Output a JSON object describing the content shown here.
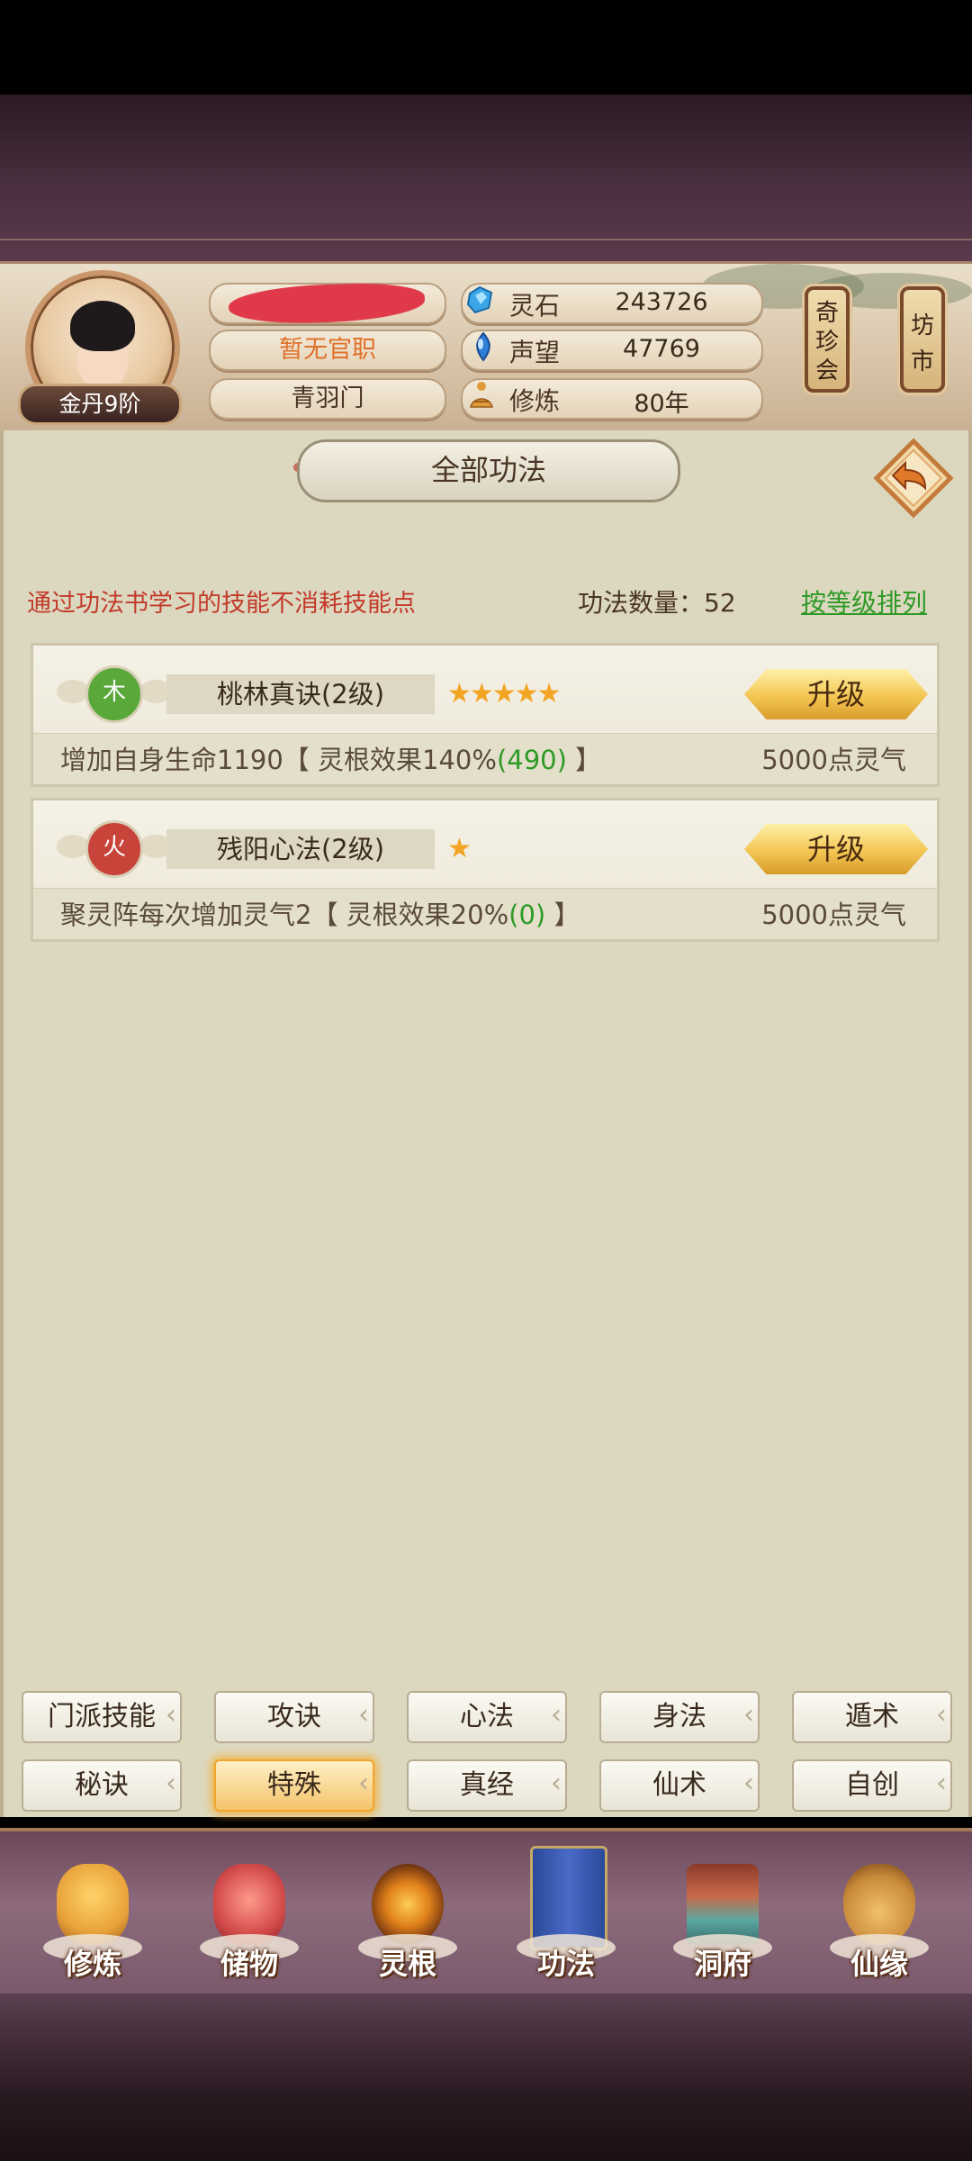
{
  "header": {
    "rank": "金丹9阶",
    "title": "暂无官职",
    "sect": "青羽门",
    "resources": [
      {
        "icon": "spirit-stone-icon",
        "label": "灵石",
        "value": "243726"
      },
      {
        "icon": "prestige-icon",
        "label": "声望",
        "value": "47769"
      },
      {
        "icon": "cultivation-icon",
        "label": "修炼",
        "value": "80年"
      }
    ],
    "side_buttons": [
      {
        "label": "奇珍会"
      },
      {
        "label": "坊市"
      }
    ]
  },
  "panel": {
    "title": "全部功法",
    "hint": "通过功法书学习的技能不消耗技能点",
    "count": "功法数量：52",
    "sort_label": "按等级排列"
  },
  "skills": [
    {
      "element": "木",
      "element_color": "#5aa83a",
      "name": "桃林真诀(2级)",
      "stars": "★★★★★",
      "upgrade_label": "升级",
      "effect_prefix": "增加自身生命1190【 灵根效果140%",
      "effect_bonus": "(490)",
      "effect_suffix": " 】",
      "cost": "5000点灵气"
    },
    {
      "element": "火",
      "element_color": "#c8433a",
      "name": "残阳心法(2级)",
      "stars": "★",
      "upgrade_label": "升级",
      "effect_prefix": "聚灵阵每次增加灵气2【 灵根效果20%",
      "effect_bonus": "(0)",
      "effect_suffix": " 】",
      "cost": "5000点灵气"
    }
  ],
  "tabs_row1": [
    "门派技能",
    "攻诀",
    "心法",
    "身法",
    "遁术"
  ],
  "tabs_row2": [
    "秘诀",
    "特殊",
    "真经",
    "仙术",
    "自创"
  ],
  "active_tab": "特殊",
  "nav": [
    {
      "label": "修炼",
      "icon": "cultivate-icon",
      "color": "#e9a23a"
    },
    {
      "label": "储物",
      "icon": "storage-bag-icon",
      "color": "#d24a4a"
    },
    {
      "label": "灵根",
      "icon": "spirit-root-icon",
      "color": "#c86a20"
    },
    {
      "label": "功法",
      "icon": "skill-book-icon",
      "color": "#3a5ab0"
    },
    {
      "label": "洞府",
      "icon": "cave-house-icon",
      "color": "#b84a3a"
    },
    {
      "label": "仙缘",
      "icon": "gourd-icon",
      "color": "#c88a3a"
    }
  ]
}
